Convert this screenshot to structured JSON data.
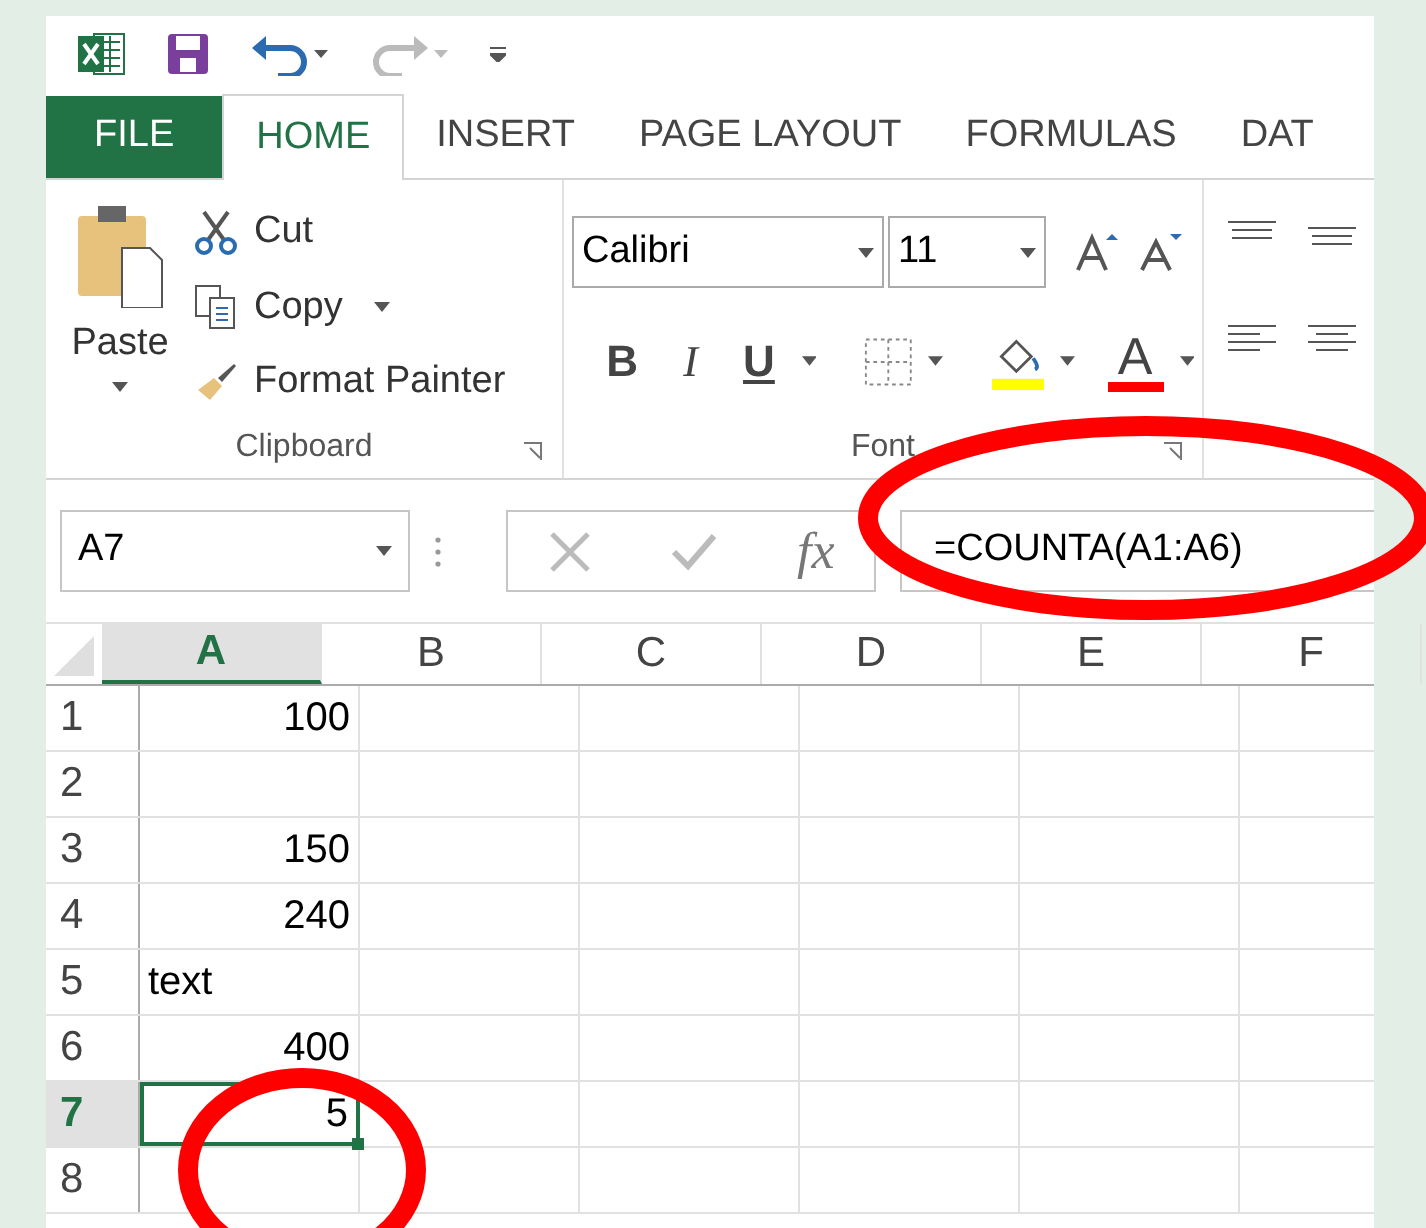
{
  "tabs": [
    {
      "label": "FILE",
      "kind": "file",
      "selected": false
    },
    {
      "label": "HOME",
      "kind": "tab",
      "selected": true
    },
    {
      "label": "INSERT",
      "kind": "tab",
      "selected": false
    },
    {
      "label": "PAGE LAYOUT",
      "kind": "tab",
      "selected": false
    },
    {
      "label": "FORMULAS",
      "kind": "tab",
      "selected": false
    },
    {
      "label": "DAT",
      "kind": "tab",
      "selected": false
    }
  ],
  "clipboard": {
    "paste": "Paste",
    "cut": "Cut",
    "copy": "Copy",
    "format_painter": "Format Painter",
    "label": "Clipboard"
  },
  "font": {
    "name": "Calibri",
    "size": "11",
    "bold": "B",
    "italic": "I",
    "underline": "U",
    "font_color": "A",
    "label": "Font"
  },
  "formula_bar": {
    "name_box": "A7",
    "fx": "fx",
    "formula": "=COUNTA(A1:A6)"
  },
  "sheet": {
    "columns": [
      {
        "label": "A",
        "selected": true
      },
      {
        "label": "B",
        "selected": false
      },
      {
        "label": "C",
        "selected": false
      },
      {
        "label": "D",
        "selected": false
      },
      {
        "label": "E",
        "selected": false
      },
      {
        "label": "F",
        "selected": false
      }
    ],
    "rows": [
      {
        "label": "1",
        "selected": false,
        "cell_a": {
          "value": "100",
          "kind": "number",
          "selected": false
        }
      },
      {
        "label": "2",
        "selected": false
      },
      {
        "label": "3",
        "selected": false,
        "cell_a": {
          "value": "150",
          "kind": "number",
          "selected": false
        }
      },
      {
        "label": "4",
        "selected": false,
        "cell_a": {
          "value": "240",
          "kind": "number",
          "selected": false
        }
      },
      {
        "label": "5",
        "selected": false,
        "cell_a": {
          "value": "text",
          "kind": "text",
          "selected": false
        }
      },
      {
        "label": "6",
        "selected": false,
        "cell_a": {
          "value": "400",
          "kind": "number",
          "selected": false
        }
      },
      {
        "label": "7",
        "selected": true,
        "cell_a": {
          "value": "5",
          "kind": "number",
          "selected": true
        }
      },
      {
        "label": "8",
        "selected": false
      }
    ]
  }
}
